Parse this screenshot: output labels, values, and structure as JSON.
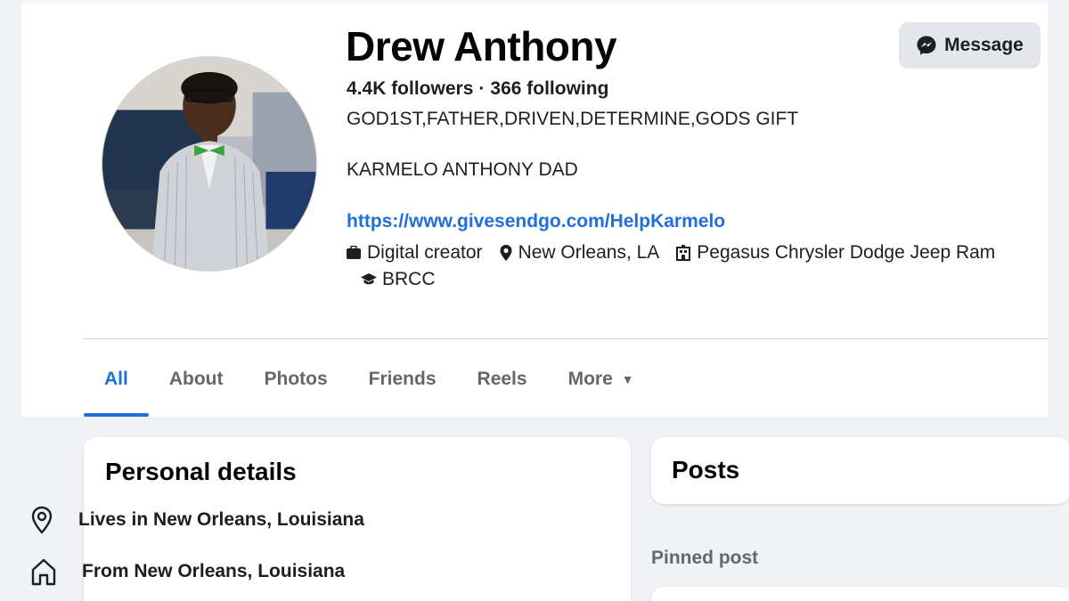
{
  "profile": {
    "name": "Drew Anthony",
    "followers": "4.4K followers",
    "separator": "·",
    "following": "366 following",
    "bio_line1": "GOD1ST,FATHER,DRIVEN,DETERMINE,GODS GIFT",
    "bio_line2": "KARMELO ANTHONY DAD",
    "link": "https://www.givesendgo.com/HelpKarmelo",
    "category": "Digital creator",
    "location": "New Orleans, LA",
    "workplace": "Pegasus Chrysler Dodge Jeep Ram",
    "education": "BRCC"
  },
  "actions": {
    "message_label": "Message"
  },
  "tabs": [
    {
      "label": "All",
      "active": true
    },
    {
      "label": "About"
    },
    {
      "label": "Photos"
    },
    {
      "label": "Friends"
    },
    {
      "label": "Reels"
    },
    {
      "label": "More"
    }
  ],
  "personal_details": {
    "title": "Personal details",
    "lives_in": "Lives in New Orleans, Louisiana",
    "from": "From New Orleans, Louisiana"
  },
  "posts": {
    "title": "Posts",
    "pinned_label": "Pinned post"
  },
  "colors": {
    "accent": "#216fdb",
    "button_bg": "#e4e6eb",
    "page_bg": "#f0f2f5"
  },
  "icons": {
    "category": "briefcase-icon",
    "location": "map-pin-icon",
    "workplace": "building-icon",
    "education": "graduation-cap-icon",
    "message": "messenger-icon",
    "lives": "location-pin-icon",
    "from": "home-icon"
  }
}
